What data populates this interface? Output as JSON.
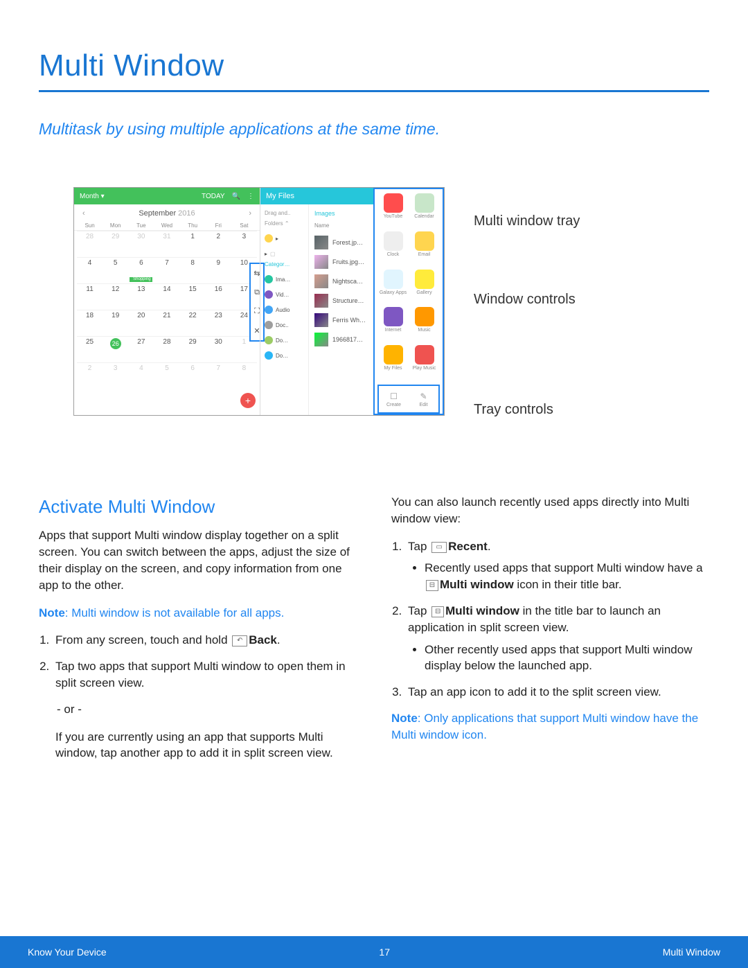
{
  "title": "Multi Window",
  "subtitle": "Multitask by using multiple applications at the same time.",
  "callouts": {
    "tray": "Multi window tray",
    "controls": "Window controls",
    "trayctrl": "Tray controls"
  },
  "calendar": {
    "month_btn": "Month ▾",
    "today": "TODAY",
    "month": "September",
    "year": "2016",
    "days": [
      "Sun",
      "Mon",
      "Tue",
      "Wed",
      "Thu",
      "Fri",
      "Sat"
    ],
    "rows": [
      [
        "28",
        "29",
        "30",
        "31",
        "1",
        "2",
        "3"
      ],
      [
        "4",
        "5",
        "6",
        "7",
        "8",
        "9",
        "10"
      ],
      [
        "11",
        "12",
        "13",
        "14",
        "15",
        "16",
        "17"
      ],
      [
        "18",
        "19",
        "20",
        "21",
        "22",
        "23",
        "24"
      ],
      [
        "25",
        "26",
        "27",
        "28",
        "29",
        "30",
        "1"
      ],
      [
        "2",
        "3",
        "4",
        "5",
        "6",
        "7",
        "8"
      ]
    ],
    "event_label": "Shopping"
  },
  "files": {
    "title": "My Files",
    "left_hdr": "Drag and..",
    "folders": "Folders ⌃",
    "categ": "Categor…",
    "cats": [
      "Ima…",
      "Vid…",
      "Audio",
      "Doc..",
      "Do…",
      "Do…"
    ],
    "crumb": "Images",
    "name": "Name",
    "items": [
      "Forest.jp…",
      "Fruits.jpg…",
      "Nightsca…",
      "Structure…",
      "Ferris Wh…",
      "1966817…"
    ]
  },
  "wc": [
    "⇆",
    "⧉",
    "⛶",
    "✕"
  ],
  "tray": {
    "apps": [
      "YouTube",
      "Calendar",
      "Clock",
      "Email",
      "Galaxy Apps",
      "Gallery",
      "Internet",
      "Music",
      "My Files",
      "Play Music"
    ],
    "colors": [
      "#ff4d4d",
      "#c8e6c9",
      "#eeeeee",
      "#ffd54f",
      "#e1f5fe",
      "#ffeb3b",
      "#7e57c2",
      "#ff9800",
      "#ffb300",
      "#ef5350"
    ],
    "create": "Create",
    "edit": "Edit"
  },
  "section": {
    "h2": "Activate Multi Window",
    "p1": "Apps that support Multi window display together on a split screen. You can switch between the apps, adjust the size of their display on the screen, and copy information from one app to the other.",
    "note1_lead": "Note",
    "note1": ": Multi window is not available for all apps.",
    "step1_pre": "From any screen, touch and hold ",
    "step1_icon": "↶",
    "step1_bold": "Back",
    "step1_post": ".",
    "step2": "Tap two apps that support Multi window to open them in split screen view.",
    "or": "- or -",
    "step2b": "If you are currently using an app that supports Multi window, tap another app to add it in split screen view.",
    "col2_intro": "You can also launch recently used apps directly into Multi window view:",
    "c2_s1_pre": "Tap ",
    "c2_s1_bold": "Recent",
    "c2_s1_post": ".",
    "c2_s1_b_pre": "Recently used apps that support Multi window have a ",
    "c2_s1_b_bold": "Multi window",
    "c2_s1_b_post": " icon in their title bar.",
    "c2_s2_pre": "Tap ",
    "c2_s2_bold": "Multi window",
    "c2_s2_post": " in the title bar to launch an application in split screen view.",
    "c2_s2_b": "Other recently used apps that support Multi window display below the launched app.",
    "c2_s3": "Tap an app icon to add it to the split screen view.",
    "note2_lead": "Note",
    "note2": ": Only applications that support Multi window have the Multi window icon."
  },
  "footer": {
    "left": "Know Your Device",
    "center": "17",
    "right": "Multi Window"
  }
}
